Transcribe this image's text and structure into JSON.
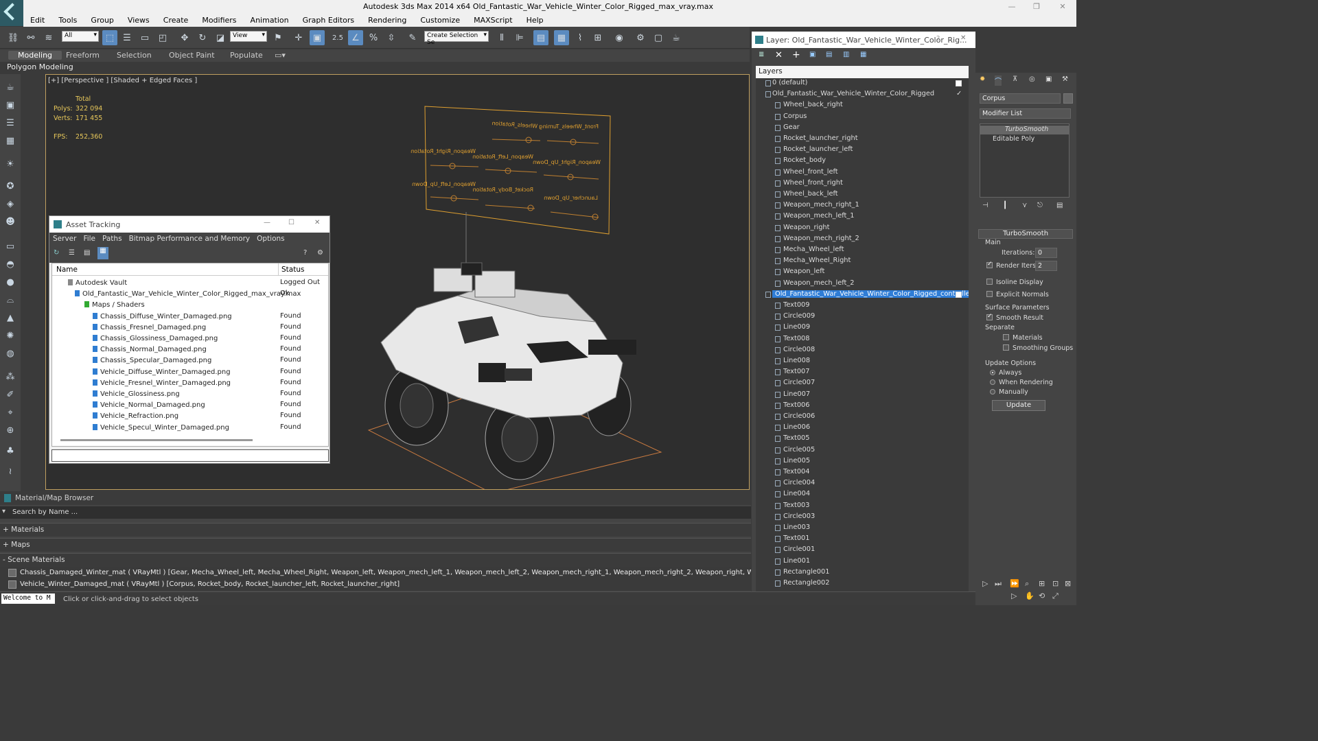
{
  "window": {
    "title": "Autodesk 3ds Max  2014 x64     Old_Fantastic_War_Vehicle_Winter_Color_Rigged_max_vray.max"
  },
  "menu": [
    "Edit",
    "Tools",
    "Group",
    "Views",
    "Create",
    "Modifiers",
    "Animation",
    "Graph Editors",
    "Rendering",
    "Customize",
    "MAXScript",
    "Help"
  ],
  "toolbar": {
    "selection_filter": "All",
    "reference_coord": "View",
    "snap_label": "2.5",
    "named_selection": "Create Selection Se"
  },
  "ribbon": {
    "tabs": [
      "Modeling",
      "Freeform",
      "Selection",
      "Object Paint",
      "Populate"
    ],
    "panel_label": "Polygon Modeling"
  },
  "viewport": {
    "label": "[+] [Perspective ] [Shaded + Edged Faces ]",
    "stats_total": "Total",
    "polys_label": "Polys:",
    "polys_value": "322 094",
    "verts_label": "Verts:",
    "verts_value": "171 455",
    "fps_label": "FPS:",
    "fps_value": "252,360"
  },
  "rig_board": {
    "labels": [
      "Wheels_Rotation",
      "Front_Wheels_Turning",
      "Weapon_Right_Rotation",
      "Weapon_Left_Rotation",
      "Weapon_Right_Up_Down",
      "Weapon_Left_Up_Down",
      "Rocket_Body_Rotation",
      "Launcher_Up_Down"
    ]
  },
  "asset_tracking": {
    "title": "Asset Tracking",
    "menu": [
      "Server",
      "File",
      "Paths",
      "Bitmap Performance and Memory",
      "Options"
    ],
    "col_name": "Name",
    "col_status": "Status",
    "rows": [
      {
        "name": "Autodesk Vault",
        "status": "Logged Out ..."
      },
      {
        "name": "Old_Fantastic_War_Vehicle_Winter_Color_Rigged_max_vray.max",
        "status": "Ok"
      },
      {
        "name": "Maps / Shaders",
        "status": ""
      },
      {
        "name": "Chassis_Diffuse_Winter_Damaged.png",
        "status": "Found"
      },
      {
        "name": "Chassis_Fresnel_Damaged.png",
        "status": "Found"
      },
      {
        "name": "Chassis_Glossiness_Damaged.png",
        "status": "Found"
      },
      {
        "name": "Chassis_Normal_Damaged.png",
        "status": "Found"
      },
      {
        "name": "Chassis_Specular_Damaged.png",
        "status": "Found"
      },
      {
        "name": "Vehicle_Diffuse_Winter_Damaged.png",
        "status": "Found"
      },
      {
        "name": "Vehicle_Fresnel_Winter_Damaged.png",
        "status": "Found"
      },
      {
        "name": "Vehicle_Glossiness.png",
        "status": "Found"
      },
      {
        "name": "Vehicle_Normal_Damaged.png",
        "status": "Found"
      },
      {
        "name": "Vehicle_Refraction.png",
        "status": "Found"
      },
      {
        "name": "Vehicle_Specul_Winter_Damaged.png",
        "status": "Found"
      }
    ]
  },
  "layer_window": {
    "title": "Layer: Old_Fantastic_War_Vehicle_Winter_Color_Rig...",
    "help": "?",
    "header": "Layers",
    "rows": [
      {
        "label": "0 (default)",
        "level": 0
      },
      {
        "label": "Old_Fantastic_War_Vehicle_Winter_Color_Rigged",
        "level": 0
      },
      {
        "label": "Wheel_back_right",
        "level": 1
      },
      {
        "label": "Corpus",
        "level": 1
      },
      {
        "label": "Gear",
        "level": 1
      },
      {
        "label": "Rocket_launcher_right",
        "level": 1
      },
      {
        "label": "Rocket_launcher_left",
        "level": 1
      },
      {
        "label": "Rocket_body",
        "level": 1
      },
      {
        "label": "Wheel_front_left",
        "level": 1
      },
      {
        "label": "Wheel_front_right",
        "level": 1
      },
      {
        "label": "Wheel_back_left",
        "level": 1
      },
      {
        "label": "Weapon_mech_right_1",
        "level": 1
      },
      {
        "label": "Weapon_mech_left_1",
        "level": 1
      },
      {
        "label": "Weapon_right",
        "level": 1
      },
      {
        "label": "Weapon_mech_right_2",
        "level": 1
      },
      {
        "label": "Mecha_Wheel_left",
        "level": 1
      },
      {
        "label": "Mecha_Wheel_Right",
        "level": 1
      },
      {
        "label": "Weapon_left",
        "level": 1
      },
      {
        "label": "Weapon_mech_left_2",
        "level": 1
      },
      {
        "label": "Old_Fantastic_War_Vehicle_Winter_Color_Rigged_controllers",
        "level": 0,
        "selected": true
      },
      {
        "label": "Text009",
        "level": 1
      },
      {
        "label": "Circle009",
        "level": 1
      },
      {
        "label": "Line009",
        "level": 1
      },
      {
        "label": "Text008",
        "level": 1
      },
      {
        "label": "Circle008",
        "level": 1
      },
      {
        "label": "Line008",
        "level": 1
      },
      {
        "label": "Text007",
        "level": 1
      },
      {
        "label": "Circle007",
        "level": 1
      },
      {
        "label": "Line007",
        "level": 1
      },
      {
        "label": "Text006",
        "level": 1
      },
      {
        "label": "Circle006",
        "level": 1
      },
      {
        "label": "Line006",
        "level": 1
      },
      {
        "label": "Text005",
        "level": 1
      },
      {
        "label": "Circle005",
        "level": 1
      },
      {
        "label": "Line005",
        "level": 1
      },
      {
        "label": "Text004",
        "level": 1
      },
      {
        "label": "Circle004",
        "level": 1
      },
      {
        "label": "Line004",
        "level": 1
      },
      {
        "label": "Text003",
        "level": 1
      },
      {
        "label": "Circle003",
        "level": 1
      },
      {
        "label": "Line003",
        "level": 1
      },
      {
        "label": "Text001",
        "level": 1
      },
      {
        "label": "Circle001",
        "level": 1
      },
      {
        "label": "Line001",
        "level": 1
      },
      {
        "label": "Rectangle001",
        "level": 1
      },
      {
        "label": "Rectangle002",
        "level": 1
      }
    ]
  },
  "command_panel": {
    "object_name": "Corpus",
    "modifier_list": "Modifier List",
    "stack": [
      "TurboSmooth",
      "Editable Poly"
    ],
    "rollout_title": "TurboSmooth",
    "main_label": "Main",
    "iterations_label": "Iterations:",
    "iterations_value": "0",
    "render_iters_label": "Render Iters:",
    "render_iters_value": "2",
    "isoline": "Isoline Display",
    "explicit_normals": "Explicit Normals",
    "surface_params": "Surface Parameters",
    "smooth_result": "Smooth Result",
    "separate": "Separate",
    "materials": "Materials",
    "smoothing_groups": "Smoothing Groups",
    "update_options": "Update Options",
    "always": "Always",
    "when_rendering": "When Rendering",
    "manually": "Manually",
    "update_btn": "Update"
  },
  "material_browser": {
    "title": "Material/Map Browser",
    "search": "Search by Name ...",
    "materials": "+ Materials",
    "maps": "+ Maps",
    "scene_materials": "- Scene Materials",
    "mat1": "Chassis_Damaged_Winter_mat  ( VRayMtl ) [Gear, Mecha_Wheel_left, Mecha_Wheel_Right, Weapon_left, Weapon_mech_left_1, Weapon_mech_left_2, Weapon_mech_right_1, Weapon_mech_right_2, Weapon_right, Wheel_back_left, Wheel_back_right, Whee",
    "mat2": "Vehicle_Winter_Damaged_mat  ( VRayMtl ) [Corpus, Rocket_body, Rocket_launcher_left, Rocket_launcher_right]"
  },
  "status": {
    "maxscript": "Welcome to M",
    "prompt": "Click or click-and-drag to select objects"
  },
  "colors": {
    "accent": "#2f7dd6",
    "rig_outline": "#e0a030",
    "stats": "#e8c85a"
  }
}
